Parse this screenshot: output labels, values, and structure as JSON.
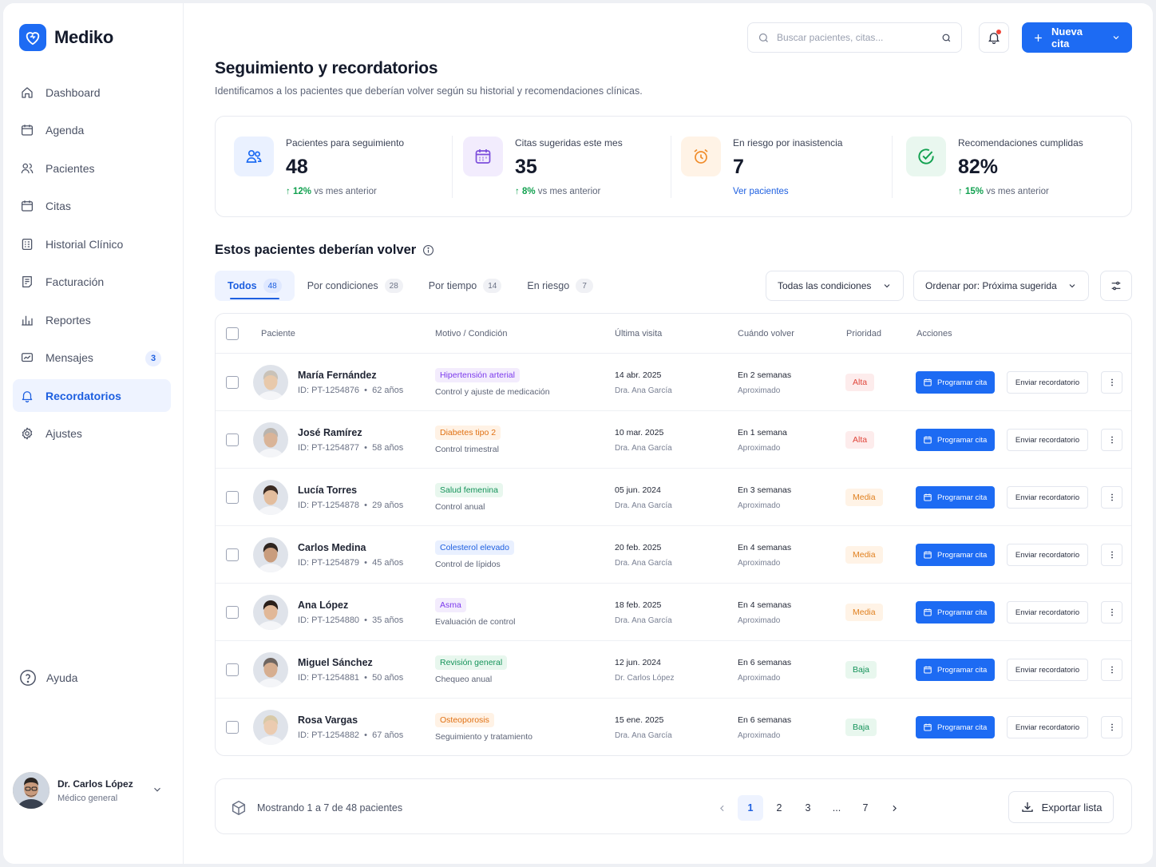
{
  "app": {
    "name": "Mediko",
    "accent": "#1d6bf3"
  },
  "sidebar": {
    "items": [
      {
        "label": "Dashboard",
        "icon": "home-icon"
      },
      {
        "label": "Agenda",
        "icon": "calendar-icon"
      },
      {
        "label": "Pacientes",
        "icon": "users-icon"
      },
      {
        "label": "Citas",
        "icon": "calendar-icon"
      },
      {
        "label": "Historial Clínico",
        "icon": "clipboard-icon"
      },
      {
        "label": "Facturación",
        "icon": "invoice-icon"
      },
      {
        "label": "Reportes",
        "icon": "bar-chart-icon"
      },
      {
        "label": "Mensajes",
        "icon": "message-icon",
        "badge": "3"
      },
      {
        "label": "Recordatorios",
        "icon": "bell-icon",
        "active": true
      },
      {
        "label": "Ajustes",
        "icon": "gear-icon"
      }
    ],
    "help": "Ayuda",
    "user": {
      "name": "Dr. Carlos López",
      "role": "Médico general"
    }
  },
  "topbar": {
    "search_placeholder": "Buscar pacientes, citas...",
    "new_button": "Nueva cita"
  },
  "page": {
    "title": "Seguimiento y recordatorios",
    "subtitle": "Identificamos a los pacientes que deberían volver según su historial y recomendaciones clínicas."
  },
  "stats": [
    {
      "label": "Pacientes para seguimiento",
      "value": "48",
      "trend": "12%",
      "trend_text": "vs mes anterior",
      "icon": "users-icon",
      "color": "#1d6bf3"
    },
    {
      "label": "Citas sugeridas este mes",
      "value": "35",
      "trend": "8%",
      "trend_text": "vs mes anterior",
      "icon": "calendar-icon",
      "color": "#7c4ddb"
    },
    {
      "label": "En riesgo por inasistencia",
      "value": "7",
      "link": "Ver pacientes",
      "icon": "alarm-clock-icon",
      "color": "#f08c2a"
    },
    {
      "label": "Recomendaciones cumplidas",
      "value": "82%",
      "trend": "15%",
      "trend_text": "vs mes anterior",
      "icon": "check-circle-icon",
      "color": "#12a150"
    }
  ],
  "section": {
    "title": "Estos pacientes deberían volver"
  },
  "tabs": [
    {
      "label": "Todos",
      "count": "48",
      "active": true
    },
    {
      "label": "Por condiciones",
      "count": "28"
    },
    {
      "label": "Por tiempo",
      "count": "14"
    },
    {
      "label": "En riesgo",
      "count": "7"
    }
  ],
  "filters": {
    "conditions": "Todas las condiciones",
    "sort": "Ordenar por: Próxima sugerida"
  },
  "table": {
    "headers": [
      "Paciente",
      "Motivo / Condición",
      "Última visita",
      "Cuándo volver",
      "Prioridad",
      "Acciones"
    ],
    "action_program": "Programar cita",
    "action_remind": "Enviar recordatorio",
    "rows": [
      {
        "name": "María Fernández",
        "id": "ID: PT-1254876",
        "age": "62 años",
        "tag": "Hipertensión arterial",
        "tag_kind": "purple",
        "condition": "Control y ajuste de medicación",
        "last_visit": "14 abr. 2025",
        "doctor": "Dra. Ana García",
        "when": "En 2 semanas",
        "approx": "Aproximado",
        "priority": "Alta",
        "avatar": {
          "skin": "#e8c9ab",
          "hair": "#c9c2b8"
        }
      },
      {
        "name": "José Ramírez",
        "id": "ID: PT-1254877",
        "age": "58 años",
        "tag": "Diabetes tipo 2",
        "tag_kind": "orange",
        "condition": "Control trimestral",
        "last_visit": "10 mar. 2025",
        "doctor": "Dra. Ana García",
        "when": "En 1 semana",
        "approx": "Aproximado",
        "priority": "Alta",
        "avatar": {
          "skin": "#d9b498",
          "hair": "#b9b4ae"
        }
      },
      {
        "name": "Lucía Torres",
        "id": "ID: PT-1254878",
        "age": "29 años",
        "tag": "Salud femenina",
        "tag_kind": "green",
        "condition": "Control anual",
        "last_visit": "05 jun. 2024",
        "doctor": "Dra. Ana García",
        "when": "En 3 semanas",
        "approx": "Aproximado",
        "priority": "Media",
        "avatar": {
          "skin": "#e3bd9d",
          "hair": "#3a2a22"
        }
      },
      {
        "name": "Carlos Medina",
        "id": "ID: PT-1254879",
        "age": "45 años",
        "tag": "Colesterol elevado",
        "tag_kind": "blue",
        "condition": "Control de lípidos",
        "last_visit": "20 feb. 2025",
        "doctor": "Dra. Ana García",
        "when": "En 4 semanas",
        "approx": "Aproximado",
        "priority": "Media",
        "avatar": {
          "skin": "#c99d7e",
          "hair": "#2e2520"
        }
      },
      {
        "name": "Ana López",
        "id": "ID: PT-1254880",
        "age": "35 años",
        "tag": "Asma",
        "tag_kind": "purple",
        "condition": "Evaluación de control",
        "last_visit": "18 feb. 2025",
        "doctor": "Dra. Ana García",
        "when": "En 4 semanas",
        "approx": "Aproximado",
        "priority": "Media",
        "avatar": {
          "skin": "#e1b898",
          "hair": "#2a1f1a"
        }
      },
      {
        "name": "Miguel Sánchez",
        "id": "ID: PT-1254881",
        "age": "50 años",
        "tag": "Revisión general",
        "tag_kind": "green",
        "condition": "Chequeo anual",
        "last_visit": "12 jun. 2024",
        "doctor": "Dr. Carlos López",
        "when": "En 6 semanas",
        "approx": "Aproximado",
        "priority": "Baja",
        "avatar": {
          "skin": "#d6ae90",
          "hair": "#6e6560"
        }
      },
      {
        "name": "Rosa Vargas",
        "id": "ID: PT-1254882",
        "age": "67 años",
        "tag": "Osteoporosis",
        "tag_kind": "orange",
        "condition": "Seguimiento y tratamiento",
        "last_visit": "15 ene. 2025",
        "doctor": "Dra. Ana García",
        "when": "En 6 semanas",
        "approx": "Aproximado",
        "priority": "Baja",
        "avatar": {
          "skin": "#ebcbb0",
          "hair": "#d8c9a8"
        }
      }
    ]
  },
  "footer": {
    "showing": "Mostrando 1 a 7 de 48 pacientes",
    "pages": [
      "1",
      "2",
      "3",
      "...",
      "7"
    ],
    "current_page": "1",
    "export": "Exportar lista"
  },
  "colors": {
    "priority_alta": {
      "bg": "#fdecec",
      "fg": "#e0453a"
    },
    "priority_media": {
      "bg": "#fff3e6",
      "fg": "#e0801f"
    },
    "priority_baja": {
      "bg": "#e8f7ee",
      "fg": "#15935a"
    },
    "tag_purple": {
      "bg": "#f3ecfd",
      "fg": "#7c3aed"
    },
    "tag_orange": {
      "bg": "#fff2e5",
      "fg": "#e07012"
    },
    "tag_green": {
      "bg": "#e8f7ee",
      "fg": "#15935a"
    },
    "tag_blue": {
      "bg": "#e9f0ff",
      "fg": "#1d5fe0"
    }
  }
}
